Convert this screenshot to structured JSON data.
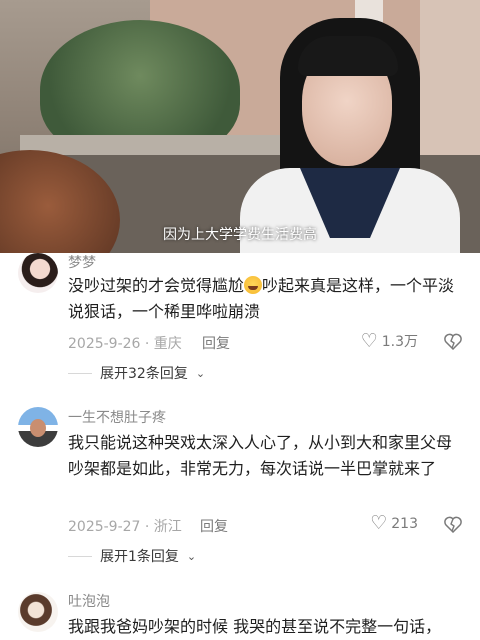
{
  "video": {
    "subtitle": "因为上大学学费生活费高"
  },
  "comments": [
    {
      "username": "梦梦",
      "text_part1": "没吵过架的才会觉得尴尬",
      "emoji": "crying-laughing-emoji",
      "text_part2": "吵起来真是这样，一个平淡说狠话，一个稀里哗啦崩溃",
      "date_location": "2025-9-26 · 重庆",
      "reply_label": "回复",
      "likes": "1.3万",
      "expand_label": "展开32条回复"
    },
    {
      "username": "一生不想肚子疼",
      "text": "我只能说这种哭戏太深入人心了，从小到大和家里父母吵架都是如此，非常无力，每次话说一半巴掌就来了",
      "date_location": "2025-9-27 · 浙江",
      "reply_label": "回复",
      "likes": "213",
      "expand_label": "展开1条回复"
    },
    {
      "username": "吐泡泡",
      "text": "我跟我爸妈吵架的时候 我哭的甚至说不完整一句话，"
    }
  ]
}
